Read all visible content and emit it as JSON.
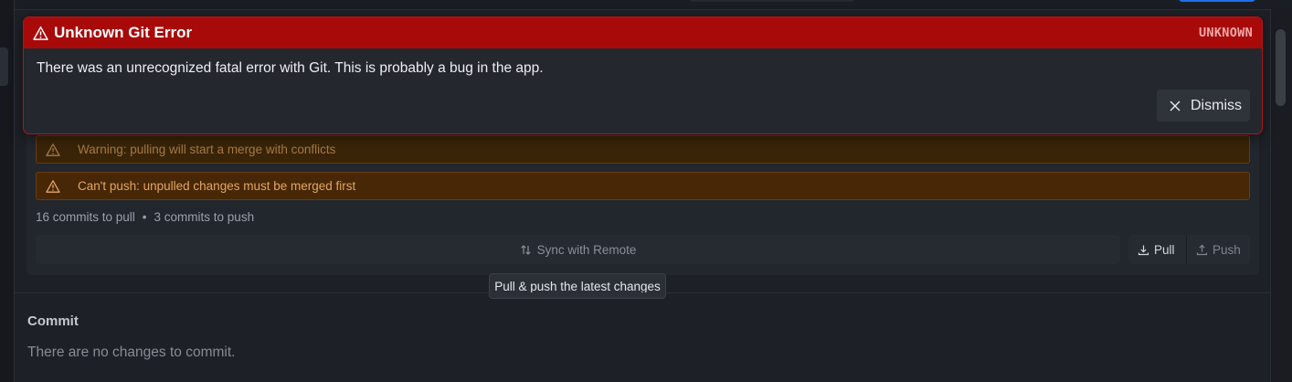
{
  "error": {
    "title": "Unknown Git Error",
    "code": "UNKNOWN",
    "message": "There was an unrecognized fatal error with Git. This is probably a bug in the app.",
    "dismiss_label": "Dismiss",
    "icon": "warning-triangle-icon",
    "color": "#a80a0a"
  },
  "warnings": [
    {
      "text": "Warning: pulling will start a merge with conflicts",
      "icon": "warning-triangle-icon"
    },
    {
      "text": "Can't push: unpulled changes must be merged first",
      "icon": "warning-triangle-icon"
    }
  ],
  "sync": {
    "commits_to_pull": "16 commits to pull",
    "separator": "•",
    "commits_to_push": "3 commits to push",
    "sync_label": "Sync with Remote",
    "sync_icon": "arrows-up-down-icon",
    "pull_label": "Pull",
    "pull_icon": "download-icon",
    "push_label": "Push",
    "push_icon": "upload-icon",
    "tooltip": "Pull & push the latest changes"
  },
  "commit": {
    "title": "Commit",
    "empty_text": "There are no changes to commit."
  },
  "colors": {
    "accent": "#1f6feb",
    "warning_border": "#6a3d08",
    "warning_text": "#e3a663"
  }
}
